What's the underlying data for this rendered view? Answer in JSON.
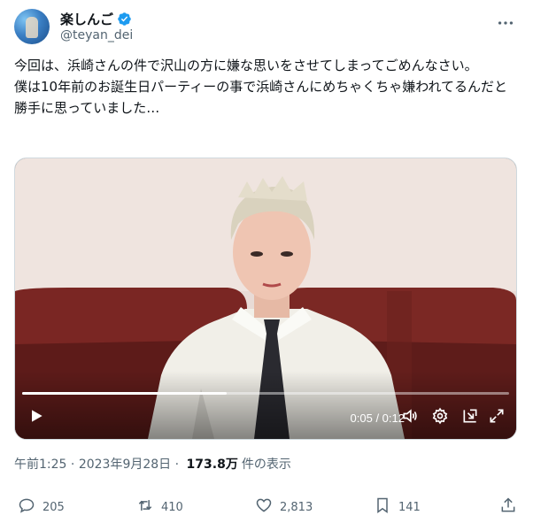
{
  "user": {
    "display_name": "楽しんご",
    "handle": "@teyan_dei"
  },
  "icons": {
    "verified": "verified-badge-icon",
    "more": "more-icon",
    "play": "play-icon",
    "volume": "volume-icon",
    "settings": "gear-icon",
    "pip": "picture-in-picture-icon",
    "fullscreen": "fullscreen-icon",
    "reply": "reply-icon",
    "retweet": "retweet-icon",
    "like": "heart-icon",
    "bookmark": "bookmark-icon",
    "share": "share-icon"
  },
  "tweet": {
    "text": "今回は、浜崎さんの件で沢山の方に嫌な思いをさせてしまってごめんなさい。\n僕は10年前のお誕生日パーティーの事で浜崎さんにめちゃくちゃ嫌われてるんだと勝手に思っていました…"
  },
  "video": {
    "time_display": "0:05 / 0:12",
    "progress_fraction": 0.42
  },
  "meta": {
    "time": "午前1:25",
    "separator": " · ",
    "date": "2023年9月28日",
    "separator2": " · ",
    "views_count": "173.8万",
    "views_label": "件の表示"
  },
  "actions": {
    "replies": "205",
    "retweets": "410",
    "likes": "2,813",
    "bookmarks": "141"
  },
  "colors": {
    "verified": "#1d9bf0",
    "secondary_text": "#536471",
    "primary_text": "#0f1419"
  }
}
